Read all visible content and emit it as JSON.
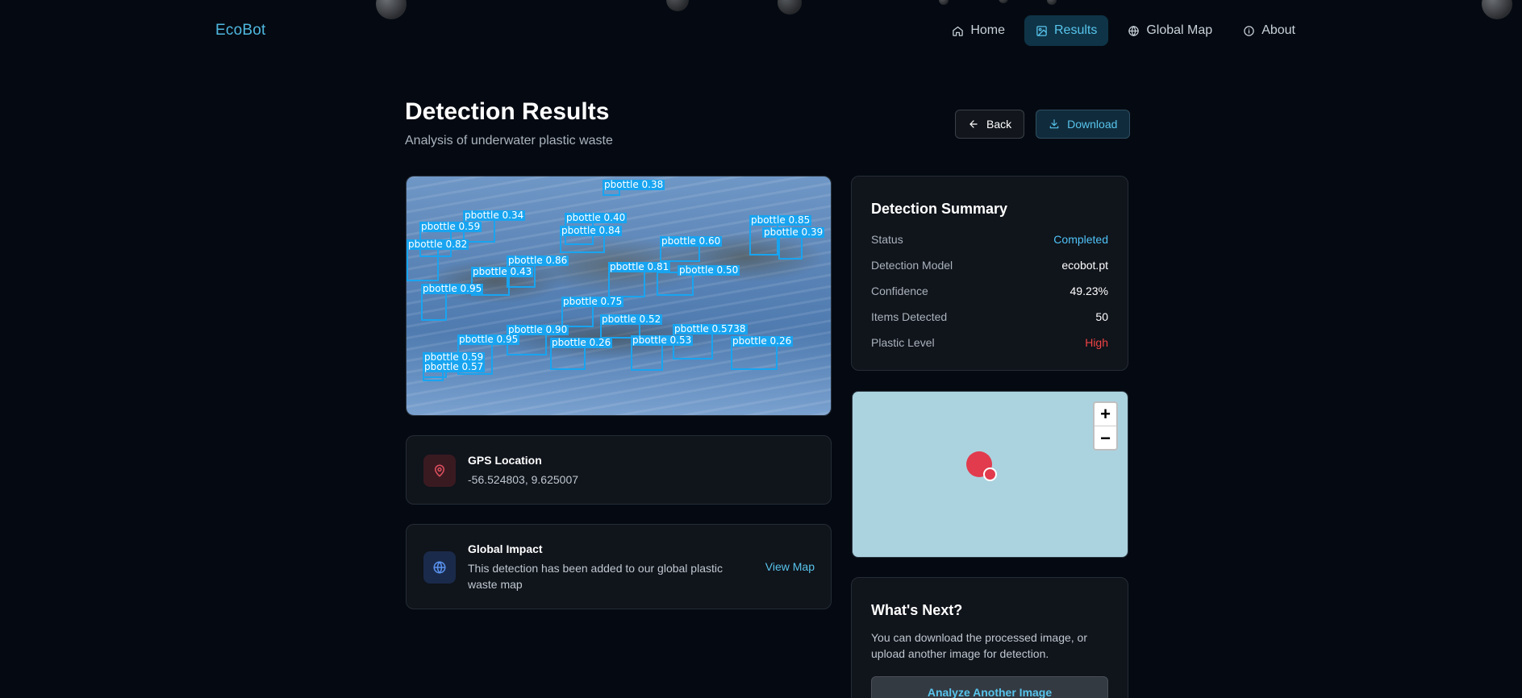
{
  "nav": {
    "logo": "EcoBot",
    "links": [
      {
        "label": "Home",
        "icon": "home-icon",
        "active": false
      },
      {
        "label": "Results",
        "icon": "image-icon",
        "active": true
      },
      {
        "label": "Global Map",
        "icon": "globe-icon",
        "active": false
      },
      {
        "label": "About",
        "icon": "info-icon",
        "active": false
      }
    ]
  },
  "header": {
    "title": "Detection Results",
    "subtitle": "Analysis of underwater plastic waste",
    "back_label": "Back",
    "download_label": "Download"
  },
  "detections": [
    {
      "label": "pbottle 0.38"
    },
    {
      "label": "pbottle 0.34"
    },
    {
      "label": "pbottle 0.40"
    },
    {
      "label": "pbottle 0.59"
    },
    {
      "label": "pbottle 0.84"
    },
    {
      "label": "pbottle 0.85"
    },
    {
      "label": "pbottle 0.39"
    },
    {
      "label": "pbottle 0.60"
    },
    {
      "label": "pbottle 0.82"
    },
    {
      "label": "pbottle 0.86"
    },
    {
      "label": "pbottle 0.43"
    },
    {
      "label": "pbottle 0.81"
    },
    {
      "label": "pbottle 0.50"
    },
    {
      "label": "pbottle 0.95"
    },
    {
      "label": "pbottle 0.75"
    },
    {
      "label": "pbottle 0.52"
    },
    {
      "label": "pbottle 0.90"
    },
    {
      "label": "pbottle 0.5738"
    },
    {
      "label": "pbottle 0.95"
    },
    {
      "label": "pbottle 0.53"
    },
    {
      "label": "pbottle 0.26"
    },
    {
      "label": "pbottle 0.26"
    },
    {
      "label": "pbottle 0.59"
    },
    {
      "label": "pbottle 0.57"
    }
  ],
  "gps": {
    "title": "GPS Location",
    "coords": "-56.524803, 9.625007"
  },
  "impact": {
    "title": "Global Impact",
    "text": "This detection has been added to our global plastic waste map",
    "link": "View Map"
  },
  "summary": {
    "title": "Detection Summary",
    "rows": [
      {
        "key": "Status",
        "value": "Completed",
        "color": "#4fc3f7"
      },
      {
        "key": "Detection Model",
        "value": "ecobot.pt",
        "color": "#ffffff"
      },
      {
        "key": "Confidence",
        "value": "49.23%",
        "color": "#ffffff"
      },
      {
        "key": "Items Detected",
        "value": "50",
        "color": "#ffffff"
      },
      {
        "key": "Plastic Level",
        "value": "High",
        "color": "#ef4444"
      }
    ]
  },
  "map": {
    "zoom_in": "+",
    "zoom_out": "−"
  },
  "next": {
    "title": "What's Next?",
    "text": "You can download the processed image, or upload another image for detection.",
    "button": "Analyze Another Image"
  }
}
